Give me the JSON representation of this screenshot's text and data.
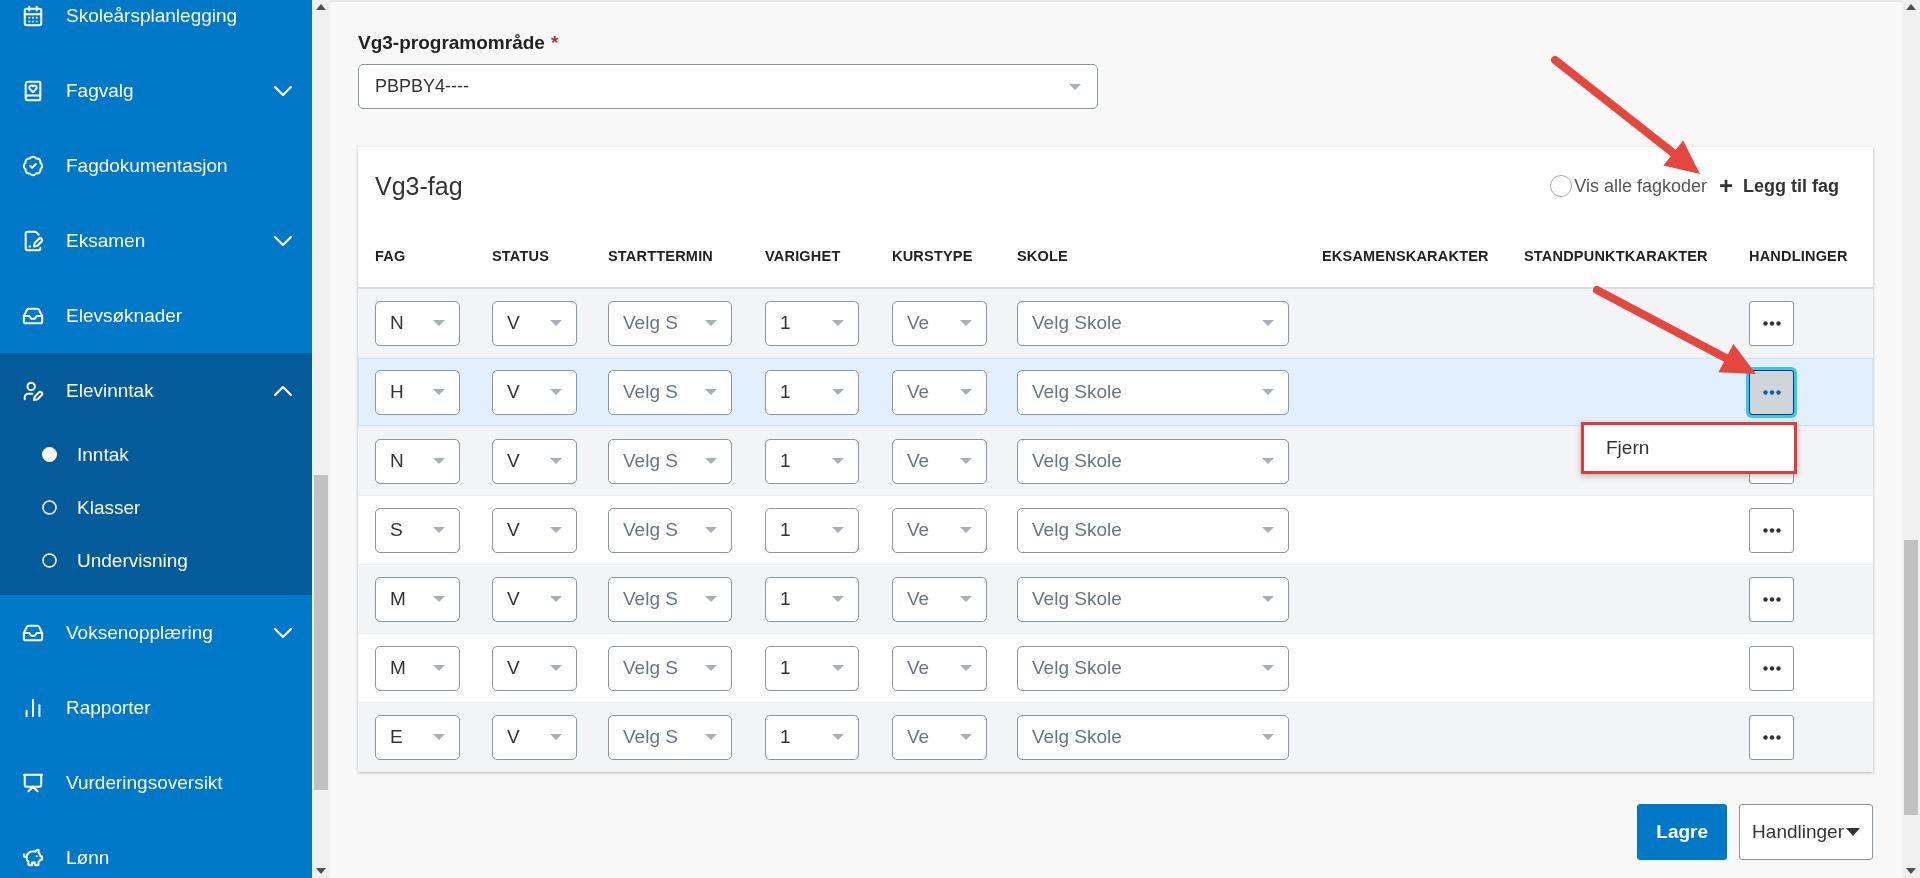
{
  "sidebar": {
    "items": [
      {
        "label": "Skoleårsplanlegging",
        "kind": "link"
      },
      {
        "label": "Fagvalg",
        "kind": "group",
        "expanded": false
      },
      {
        "label": "Fagdokumentasjon",
        "kind": "link"
      },
      {
        "label": "Eksamen",
        "kind": "group",
        "expanded": false
      },
      {
        "label": "Elevsøknader",
        "kind": "link"
      },
      {
        "label": "Elevinntak",
        "kind": "group",
        "expanded": true,
        "children": [
          {
            "label": "Inntak",
            "selected": true
          },
          {
            "label": "Klasser",
            "selected": false
          },
          {
            "label": "Undervisning",
            "selected": false
          }
        ]
      },
      {
        "label": "Voksenopplæring",
        "kind": "group",
        "expanded": false
      },
      {
        "label": "Rapporter",
        "kind": "link"
      },
      {
        "label": "Vurderingsoversikt",
        "kind": "link"
      },
      {
        "label": "Lønn",
        "kind": "link"
      }
    ]
  },
  "program_field": {
    "label": "Vg3-programområde",
    "required_mark": "*",
    "value": "PBPBY4----"
  },
  "subjects": {
    "title": "Vg3-fag",
    "show_all_codes": {
      "label": "Vis alle fagkoder",
      "checked": false
    },
    "add_button": {
      "icon": "+",
      "label": "Legg til fag"
    },
    "columns": [
      "FAG",
      "STATUS",
      "STARTTERMIN",
      "VARIGHET",
      "KURSTYPE",
      "SKOLE",
      "EKSAMENSKARAKTER",
      "STANDPUNKTKARAKTER",
      "HANDLINGER"
    ],
    "rows": [
      {
        "selected": false,
        "cells": [
          {
            "value": "N"
          },
          {
            "value": "V"
          },
          {
            "placeholder": "Velg S"
          },
          {
            "value": "1"
          },
          {
            "placeholder": "Ve"
          },
          {
            "placeholder": "Velg Skole"
          }
        ]
      },
      {
        "selected": true,
        "cells": [
          {
            "value": "H"
          },
          {
            "value": "V"
          },
          {
            "placeholder": "Velg S"
          },
          {
            "value": "1"
          },
          {
            "placeholder": "Ve"
          },
          {
            "placeholder": "Velg Skole"
          }
        ],
        "menu": {
          "items": [
            "Fjern"
          ]
        }
      },
      {
        "selected": false,
        "cells": [
          {
            "value": "N"
          },
          {
            "value": "V"
          },
          {
            "placeholder": "Velg S"
          },
          {
            "value": "1"
          },
          {
            "placeholder": "Ve"
          },
          {
            "placeholder": "Velg Skole"
          }
        ]
      },
      {
        "selected": false,
        "cells": [
          {
            "value": "S"
          },
          {
            "value": "V"
          },
          {
            "placeholder": "Velg S"
          },
          {
            "value": "1"
          },
          {
            "placeholder": "Ve"
          },
          {
            "placeholder": "Velg Skole"
          }
        ]
      },
      {
        "selected": false,
        "cells": [
          {
            "value": "M"
          },
          {
            "value": "V"
          },
          {
            "placeholder": "Velg S"
          },
          {
            "value": "1"
          },
          {
            "placeholder": "Ve"
          },
          {
            "placeholder": "Velg Skole"
          }
        ]
      },
      {
        "selected": false,
        "cells": [
          {
            "value": "M"
          },
          {
            "value": "V"
          },
          {
            "placeholder": "Velg S"
          },
          {
            "value": "1"
          },
          {
            "placeholder": "Ve"
          },
          {
            "placeholder": "Velg Skole"
          }
        ]
      },
      {
        "selected": false,
        "cells": [
          {
            "value": "E"
          },
          {
            "value": "V"
          },
          {
            "placeholder": "Velg S"
          },
          {
            "value": "1"
          },
          {
            "placeholder": "Ve"
          },
          {
            "placeholder": "Velg Skole"
          }
        ]
      }
    ]
  },
  "footer_buttons": [
    {
      "label": "Lagre",
      "kind": "primary"
    },
    {
      "label": "Handlinger",
      "kind": "dropdown"
    }
  ],
  "annotations": [
    {
      "kind": "arrow"
    },
    {
      "kind": "arrow"
    }
  ]
}
